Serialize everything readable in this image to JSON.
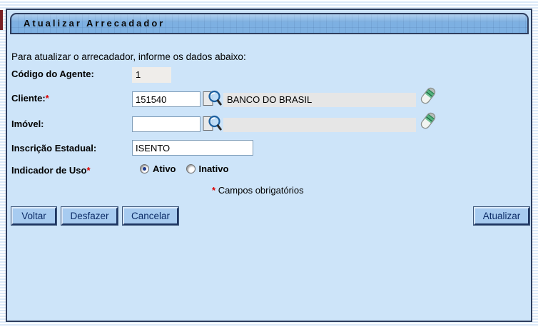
{
  "panel": {
    "title": "Atualizar Arrecadador",
    "instruction": "Para atualizar o arrecadador, informe os dados abaixo:"
  },
  "form": {
    "codigo_agente": {
      "label": "Código do Agente:",
      "value": "1"
    },
    "cliente": {
      "label": "Cliente:",
      "required_mark": "*",
      "code": "151540",
      "name": "BANCO DO BRASIL"
    },
    "imovel": {
      "label": "Imóvel:",
      "code": "",
      "name": ""
    },
    "inscricao_estadual": {
      "label": "Inscrição Estadual:",
      "value": "ISENTO"
    },
    "indicador_de_uso": {
      "label": "Indicador de Uso",
      "required_mark": "*",
      "options": [
        {
          "label": "Ativo",
          "selected": true
        },
        {
          "label": "Inativo",
          "selected": false
        }
      ]
    },
    "required_note": {
      "mark": "*",
      "text": "Campos obrigatórios"
    }
  },
  "buttons": {
    "voltar": "Voltar",
    "desfazer": "Desfazer",
    "cancelar": "Cancelar",
    "atualizar": "Atualizar"
  },
  "icons": {
    "search": "search-icon",
    "eraser": "eraser-icon"
  },
  "colors": {
    "panel_bg": "#cde4f9",
    "panel_border": "#2e3e5e",
    "title_bar_bg": "#7db0e2",
    "button_bg": "#a7cbf0",
    "button_text": "#0b2b66",
    "required_red": "#dd0000",
    "edge_accent": "#7a2125",
    "disabled_field_bg": "#efedea",
    "readonly_field_bg": "#e6e6e6"
  }
}
